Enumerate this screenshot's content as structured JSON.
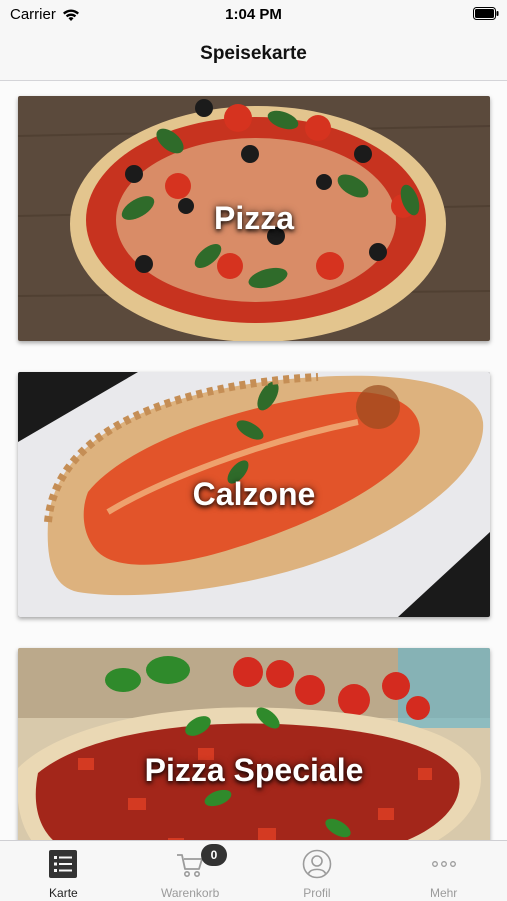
{
  "status_bar": {
    "carrier": "Carrier",
    "time": "1:04 PM",
    "wifi_icon": "wifi-icon",
    "battery_icon": "battery-icon"
  },
  "nav": {
    "title": "Speisekarte"
  },
  "categories": [
    {
      "label": "Pizza"
    },
    {
      "label": "Calzone"
    },
    {
      "label": "Pizza Speciale"
    }
  ],
  "tab_bar": {
    "items": [
      {
        "label": "Karte",
        "icon": "menu-list-icon",
        "active": true
      },
      {
        "label": "Warenkorb",
        "icon": "cart-icon",
        "badge": "0"
      },
      {
        "label": "Profil",
        "icon": "profile-icon"
      },
      {
        "label": "Mehr",
        "icon": "more-icon"
      }
    ]
  },
  "colors": {
    "active_tab": "#222222",
    "inactive_tab": "#9b9b9b",
    "badge_bg": "#333333"
  }
}
